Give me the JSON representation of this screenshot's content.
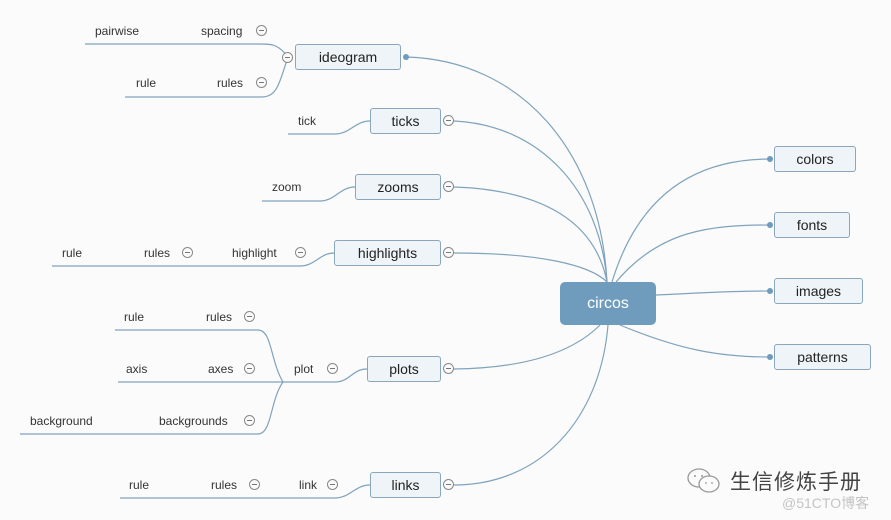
{
  "root": {
    "label": "circos"
  },
  "left_branches": [
    {
      "id": "ideogram",
      "label": "ideogram",
      "children": [
        {
          "label": "spacing",
          "children": [
            {
              "label": "pairwise"
            }
          ]
        },
        {
          "label": "rules",
          "children": [
            {
              "label": "rule"
            }
          ]
        }
      ]
    },
    {
      "id": "ticks",
      "label": "ticks",
      "children": [
        {
          "label": "tick"
        }
      ]
    },
    {
      "id": "zooms",
      "label": "zooms",
      "children": [
        {
          "label": "zoom"
        }
      ]
    },
    {
      "id": "highlights",
      "label": "highlights",
      "children": [
        {
          "label": "highlight",
          "children": [
            {
              "label": "rules",
              "children": [
                {
                  "label": "rule"
                }
              ]
            }
          ]
        }
      ]
    },
    {
      "id": "plots",
      "label": "plots",
      "children": [
        {
          "label": "plot",
          "children": [
            {
              "label": "rules",
              "children": [
                {
                  "label": "rule"
                }
              ]
            },
            {
              "label": "axes",
              "children": [
                {
                  "label": "axis"
                }
              ]
            },
            {
              "label": "backgrounds",
              "children": [
                {
                  "label": "background"
                }
              ]
            }
          ]
        }
      ]
    },
    {
      "id": "links",
      "label": "links",
      "children": [
        {
          "label": "link",
          "children": [
            {
              "label": "rules",
              "children": [
                {
                  "label": "rule"
                }
              ]
            }
          ]
        }
      ]
    }
  ],
  "right_branches": [
    {
      "id": "colors",
      "label": "colors"
    },
    {
      "id": "fonts",
      "label": "fonts"
    },
    {
      "id": "images",
      "label": "images"
    },
    {
      "id": "patterns",
      "label": "patterns"
    }
  ],
  "watermark": {
    "icon": "wechat-icon",
    "title": "生信修炼手册",
    "subtitle": "@51CTO博客"
  },
  "colors": {
    "line": "#7fa3bd",
    "root_fill": "#6f9cbc",
    "node_fill": "#eef4f8",
    "node_border": "#8aa6bb"
  }
}
